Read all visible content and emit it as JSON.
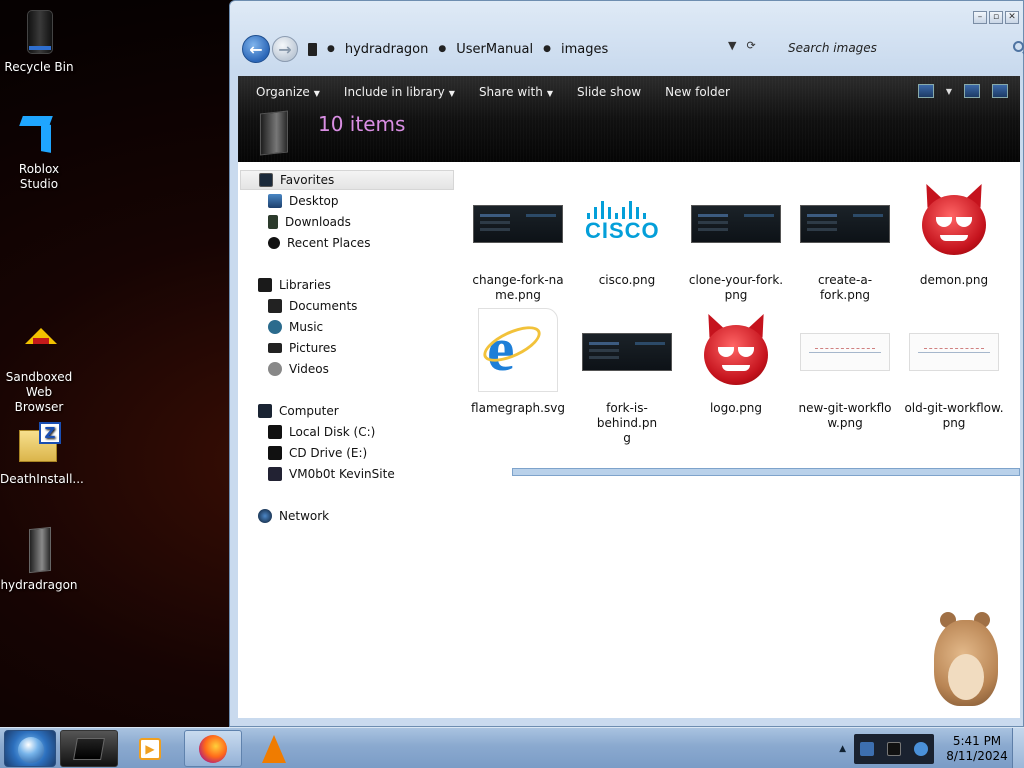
{
  "desktop": {
    "icons": [
      {
        "label": "Recycle Bin",
        "icon": "recycle-bin-icon"
      },
      {
        "label": "Roblox Studio",
        "icon": "roblox-studio-icon"
      },
      {
        "label": "Sandboxed Web Browser",
        "icon": "sandboxed-browser-icon"
      },
      {
        "label": "DeathInstall...",
        "icon": "zip-archive-icon"
      },
      {
        "label": "hydradragon",
        "icon": "folder-icon"
      }
    ]
  },
  "explorer": {
    "breadcrumb": [
      "hydradragon",
      "UserManual",
      "images"
    ],
    "search_placeholder": "Search images",
    "toolbar": {
      "organize": "Organize",
      "include_in_library": "Include in library",
      "share_with": "Share with",
      "slide_show": "Slide show",
      "new_folder": "New folder"
    },
    "item_count": "10 items",
    "nav": {
      "favorites": "Favorites",
      "desktop": "Desktop",
      "downloads": "Downloads",
      "recent_places": "Recent Places",
      "libraries": "Libraries",
      "documents": "Documents",
      "music": "Music",
      "pictures": "Pictures",
      "videos": "Videos",
      "computer": "Computer",
      "local_disk": "Local Disk (C:)",
      "cd_drive": "CD Drive (E:)",
      "vm_site": "VM0b0t KevinSite",
      "network": "Network"
    },
    "files": [
      {
        "name": "change-fork-na\nme.png",
        "thumb": "screenshot"
      },
      {
        "name": "cisco.png",
        "thumb": "cisco-logo"
      },
      {
        "name": "clone-your-fork.\npng",
        "thumb": "screenshot"
      },
      {
        "name": "create-a-fork.png",
        "thumb": "screenshot"
      },
      {
        "name": "demon.png",
        "thumb": "demon"
      },
      {
        "name": "flamegraph.svg",
        "thumb": "ie-icon"
      },
      {
        "name": "fork-is-behind.pn\ng",
        "thumb": "screenshot"
      },
      {
        "name": "logo.png",
        "thumb": "demon"
      },
      {
        "name": "new-git-workflo\nw.png",
        "thumb": "diagram"
      },
      {
        "name": "old-git-workflow.\npng",
        "thumb": "diagram"
      }
    ]
  },
  "taskbar": {
    "time": "5:41 PM",
    "date": "8/11/2024"
  },
  "colors": {
    "item_count_text": "#d98ee3",
    "cisco_blue": "#049fd9",
    "demon_red": "#c5131d"
  }
}
